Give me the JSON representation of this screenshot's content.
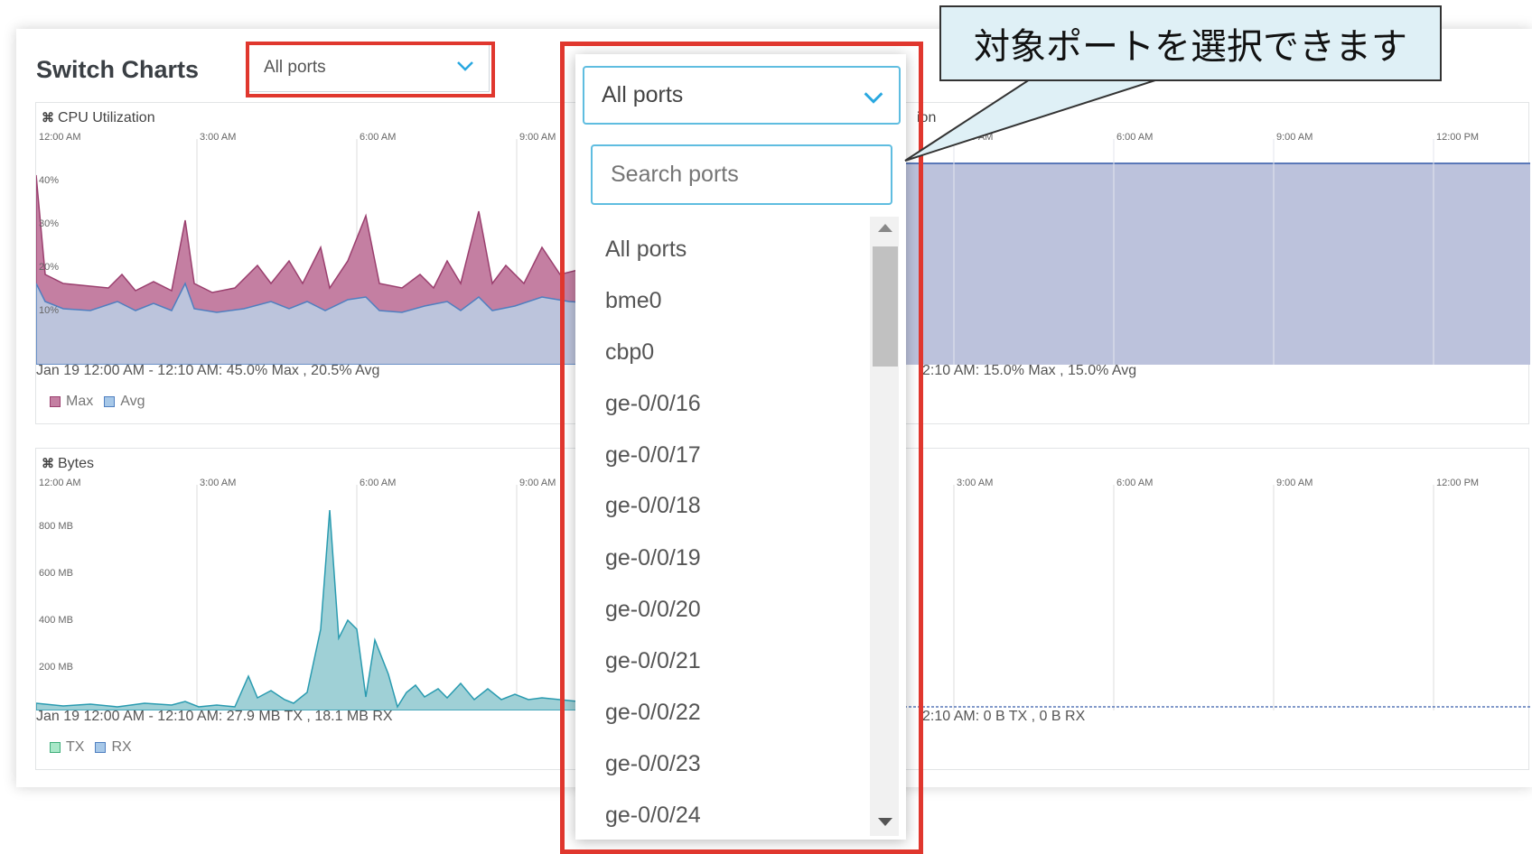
{
  "page": {
    "title": "Switch Charts"
  },
  "header_select": {
    "value": "All ports"
  },
  "cpu_panel": {
    "title": "CPU Utilization",
    "x_ticks": [
      "12:00 AM",
      "3:00 AM",
      "6:00 AM",
      "9:00 AM"
    ],
    "y_ticks": [
      "40%",
      "30%",
      "20%",
      "10%"
    ],
    "summary": "Jan 19 12:00 AM - 12:10 AM: 45.0% Max , 20.5% Avg",
    "legend": [
      {
        "label": "Max",
        "color": "#b56a8f"
      },
      {
        "label": "Avg",
        "color": "#6fa8dc"
      }
    ]
  },
  "memory_panel": {
    "title_fragment": "ion",
    "x_ticks": [
      "3:00 AM",
      "6:00 AM",
      "9:00 AM",
      "12:00 PM"
    ],
    "summary": "2:10 AM: 15.0% Max , 15.0% Avg"
  },
  "bytes_panel": {
    "title": "Bytes",
    "x_ticks": [
      "12:00 AM",
      "3:00 AM",
      "6:00 AM",
      "9:00 AM"
    ],
    "y_ticks": [
      "800 MB",
      "600 MB",
      "400 MB",
      "200 MB"
    ],
    "summary": "Jan 19 12:00 AM - 12:10 AM: 27.9 MB TX , 18.1 MB RX",
    "legend": [
      {
        "label": "TX",
        "color": "#6fd6a8"
      },
      {
        "label": "RX",
        "color": "#6fa8dc"
      }
    ]
  },
  "traffic_panel": {
    "x_ticks": [
      "3:00 AM",
      "6:00 AM",
      "9:00 AM",
      "12:00 PM"
    ],
    "summary": "2:10 AM: 0 B TX , 0 B RX"
  },
  "dropdown": {
    "selected": "All ports",
    "search_placeholder": "Search ports",
    "options": [
      "All ports",
      "bme0",
      "cbp0",
      "ge-0/0/16",
      "ge-0/0/17",
      "ge-0/0/18",
      "ge-0/0/19",
      "ge-0/0/20",
      "ge-0/0/21",
      "ge-0/0/22",
      "ge-0/0/23",
      "ge-0/0/24"
    ]
  },
  "callout": {
    "text": "対象ポートを選択できます"
  },
  "colors": {
    "highlight": "#e0372e",
    "accent": "#29a8e0",
    "cpu_max": "#b56a8f",
    "cpu_avg": "#6fa8dc",
    "mem_fill": "#bcc2dc",
    "bytes_fill": "#9fd0d6",
    "bytes_line": "#2a9bb0"
  },
  "icons": {
    "panel_expand": "expand-icon",
    "select_chevron": "chevron-down-icon"
  }
}
